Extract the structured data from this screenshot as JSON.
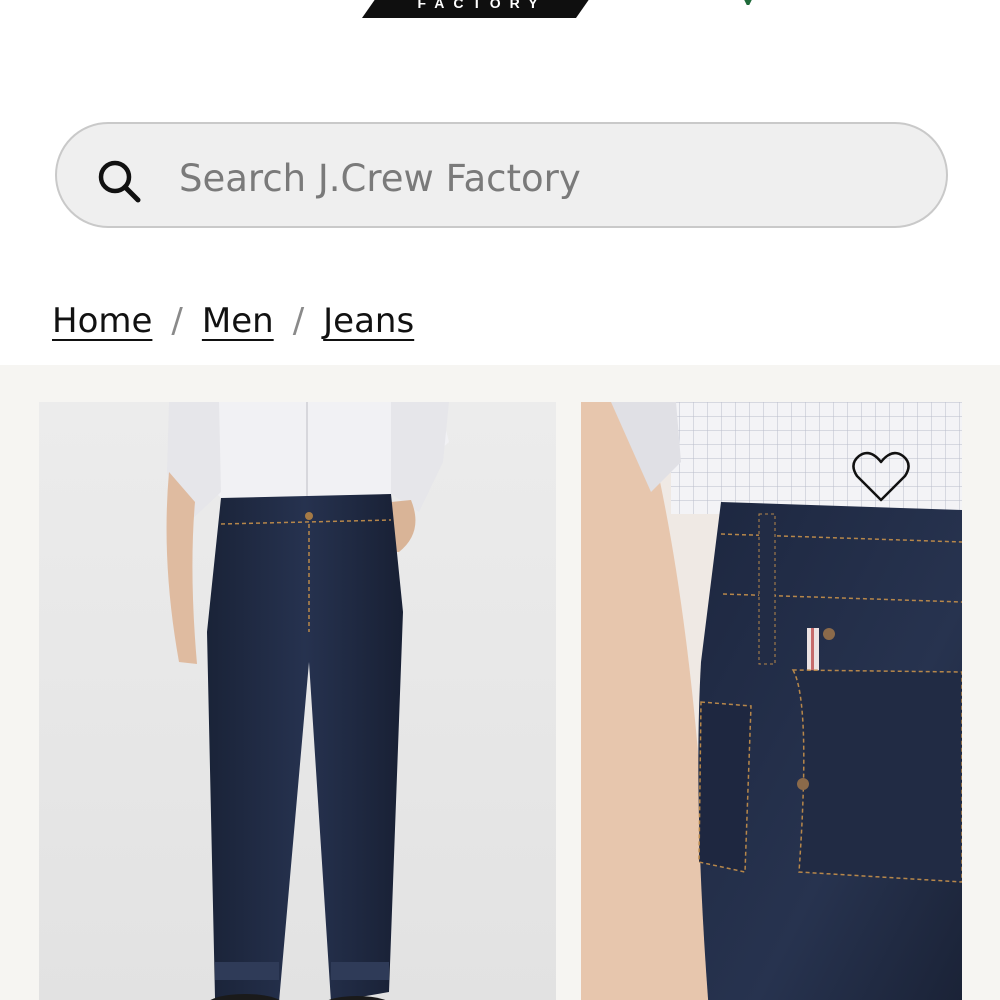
{
  "header": {
    "logo_text": "FACTORY",
    "logo_icon": "jcrew-factory-logo",
    "right_icon": "leaf-icon"
  },
  "search": {
    "placeholder": "Search J.Crew Factory",
    "value": "",
    "icon": "search-icon"
  },
  "breadcrumb": {
    "items": [
      {
        "label": "Home"
      },
      {
        "label": "Men"
      },
      {
        "label": "Jeans"
      }
    ],
    "separator": "/"
  },
  "gallery": {
    "images": [
      {
        "subject": "model wearing dark rinse jeans with white shirt"
      },
      {
        "subject": "close-up of back pocket and selvedge detail"
      }
    ],
    "wishlist_icon": "heart-icon"
  },
  "colors": {
    "denim": "#1f2a44",
    "gallery_bg": "#f6f5f2",
    "search_bg": "#efefef"
  }
}
